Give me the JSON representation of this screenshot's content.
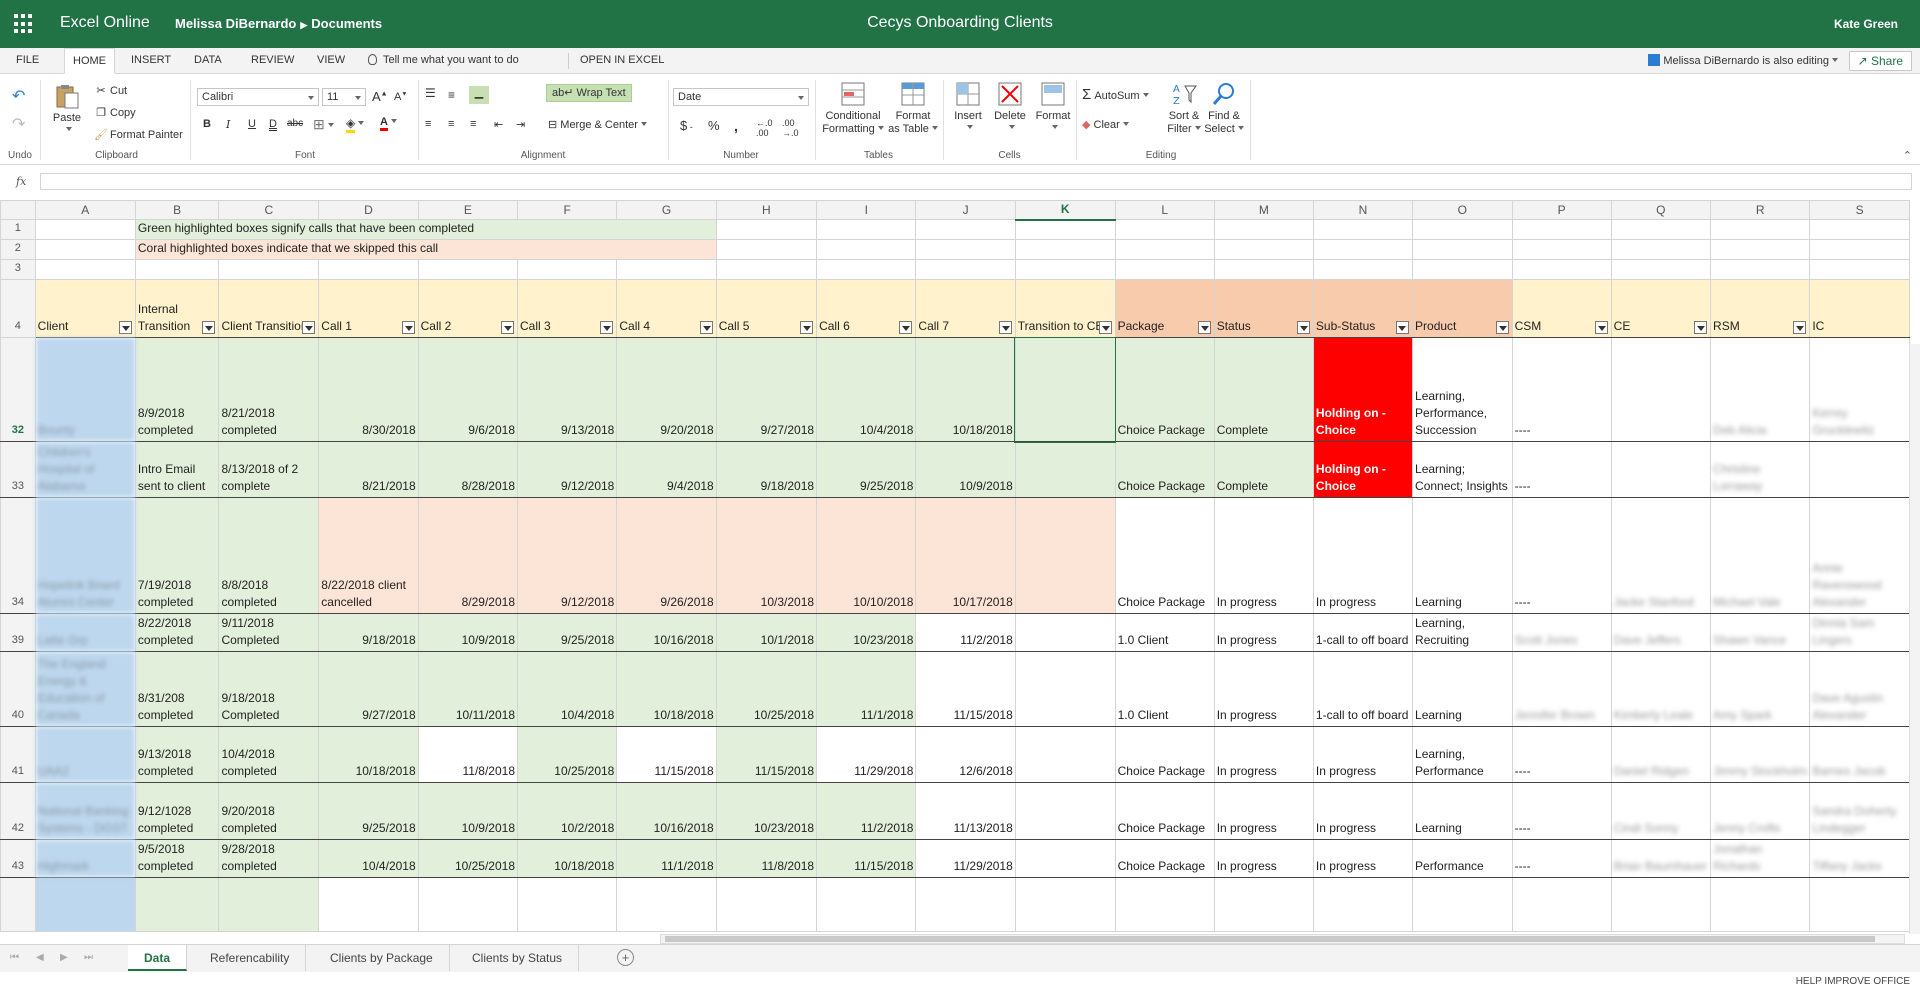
{
  "titlebar": {
    "app": "Excel Online",
    "owner": "Melissa DiBernardo",
    "folder": "Documents",
    "document": "Cecys Onboarding Clients",
    "user": "Kate Green"
  },
  "menu": {
    "tabs": [
      "FILE",
      "HOME",
      "INSERT",
      "DATA",
      "REVIEW",
      "VIEW"
    ],
    "tell_me": "Tell me what you want to do",
    "open_in_excel": "OPEN IN EXCEL",
    "coediting": "Melissa DiBernardo is also editing",
    "share": "Share"
  },
  "ribbon": {
    "undo": "Undo",
    "clipboard": {
      "paste": "Paste",
      "cut": "Cut",
      "copy": "Copy",
      "format_painter": "Format Painter",
      "label": "Clipboard"
    },
    "font": {
      "name": "Calibri",
      "size": "11",
      "label": "Font",
      "bold": "B",
      "italic": "I",
      "underline": "U",
      "double_underline": "D",
      "strike": "abc"
    },
    "alignment": {
      "wrap": "Wrap Text",
      "merge": "Merge & Center",
      "label": "Alignment"
    },
    "number": {
      "format": "Date",
      "currency": "$",
      "percent": "%",
      "comma": ",",
      "label": "Number"
    },
    "tables": {
      "conditional1": "Conditional",
      "conditional2": "Formatting",
      "format_table1": "Format",
      "format_table2": "as Table",
      "label": "Tables"
    },
    "cells": {
      "insert": "Insert",
      "delete": "Delete",
      "format": "Format",
      "label": "Cells"
    },
    "editing": {
      "autosum": "AutoSum",
      "clear": "Clear",
      "sort1": "Sort &",
      "sort2": "Filter",
      "find1": "Find &",
      "find2": "Select",
      "label": "Editing"
    }
  },
  "formula_bar": {
    "fx": "fx",
    "value": ""
  },
  "columns": [
    "A",
    "B",
    "C",
    "D",
    "E",
    "F",
    "G",
    "H",
    "I",
    "J",
    "K",
    "L",
    "M",
    "N",
    "O",
    "P",
    "Q",
    "R",
    "S"
  ],
  "selected_column": "K",
  "notes": {
    "row1": "Green highlighted boxes signify calls that have been completed",
    "row2": "Coral highlighted boxes indicate that we skipped this call"
  },
  "headers": [
    "Client",
    "Internal Transition",
    "Client Transition",
    "Call 1",
    "Call 2",
    "Call 3",
    "Call 4",
    "Call 5",
    "Call 6",
    "Call 7",
    "Transition to CE",
    "Package",
    "Status",
    "Sub-Status",
    "Product",
    "CSM",
    "CE",
    "RSM",
    "IC"
  ],
  "rows": [
    {
      "rownum": "32",
      "cells": [
        "Bounty",
        "8/9/2018 completed",
        "8/21/2018 completed",
        "8/30/2018",
        "9/6/2018",
        "9/13/2018",
        "9/20/2018",
        "9/27/2018",
        "10/4/2018",
        "10/18/2018",
        "",
        "Choice Package",
        "Complete",
        "Holding on - Choice",
        "Learning, Performance, Succession",
        "----",
        "",
        "Deb Alicia",
        "Kerrey Grucklewitz"
      ]
    },
    {
      "rownum": "33",
      "cells": [
        "Children's Hospital of Alabama",
        "Intro Email sent to client",
        "8/13/2018   of 2 complete",
        "8/21/2018",
        "8/28/2018",
        "9/12/2018",
        "9/4/2018",
        "9/18/2018",
        "9/25/2018",
        "10/9/2018",
        "",
        "Choice Package",
        "Complete",
        "Holding on - Choice",
        "Learning; Connect; Insights",
        "----",
        "",
        "Christine Lorraway",
        ""
      ]
    },
    {
      "rownum": "34",
      "cells": [
        "Hopelink Board Alumni Center",
        "7/19/2018 completed",
        "8/8/2018 completed",
        "8/22/2018 client cancelled",
        "8/29/2018",
        "9/12/2018",
        "9/26/2018",
        "10/3/2018",
        "10/10/2018",
        "10/17/2018",
        "",
        "Choice Package",
        "In progress",
        "In progress",
        "Learning",
        "----",
        "Jacke Stanford",
        "Michael Vale",
        "Annie Ravenswood Alexander"
      ]
    },
    {
      "rownum": "39",
      "cells": [
        "Latte Grp",
        "8/22/2018 completed",
        "9/11/2018 Completed",
        "9/18/2018",
        "10/9/2018",
        "9/25/2018",
        "10/16/2018",
        "10/1/2018",
        "10/23/2018",
        "11/2/2018",
        "",
        "1.0 Client",
        "In progress",
        "1-call to off board",
        "Learning, Recruiting",
        "Scott Jones",
        "Dave Jeffers",
        "Shawn Vance",
        "Dinnia Sam Lingers"
      ]
    },
    {
      "rownum": "40",
      "cells": [
        "The England Energy & Education of Canada",
        "8/31/208 completed",
        "9/18/2018 Completed",
        "9/27/2018",
        "10/11/2018",
        "10/4/2018",
        "10/18/2018",
        "10/25/2018",
        "11/1/2018",
        "11/15/2018",
        "",
        "1.0 Client",
        "In progress",
        "1-call to off board",
        "Learning",
        "Jennifer Brown",
        "Kimberly Leale",
        "Amy Spark",
        "Dave Agustin Alexander"
      ]
    },
    {
      "rownum": "41",
      "cells": [
        "UAA2",
        "9/13/2018 completed",
        "10/4/2018 completed",
        "10/18/2018",
        "11/8/2018",
        "10/25/2018",
        "11/15/2018",
        "11/15/2018",
        "11/29/2018",
        "12/6/2018",
        "",
        "Choice Package",
        "In progress",
        "In progress",
        "Learning, Performance",
        "----",
        "Daniel Ridgen",
        "Jimmy Stockholm",
        "Barnes Jacob"
      ]
    },
    {
      "rownum": "42",
      "cells": [
        "National Banking Systems - DGST",
        "9/12/1028 completed",
        "9/20/2018 completed",
        "9/25/2018",
        "10/9/2018",
        "10/2/2018",
        "10/16/2018",
        "10/23/2018",
        "11/2/2018",
        "11/13/2018",
        "",
        "Choice Package",
        "In progress",
        "In progress",
        "Learning",
        "----",
        "Cindi Sonny",
        "Jenny Crofts",
        "Sandra Doherty Lindegger"
      ]
    },
    {
      "rownum": "43",
      "cells": [
        "Highmark",
        "9/5/2018 completed",
        "9/28/2018 completed",
        "10/4/2018",
        "10/25/2018",
        "10/18/2018",
        "11/1/2018",
        "11/8/2018",
        "11/15/2018",
        "11/29/2018",
        "",
        "Choice Package",
        "In progress",
        "In progress",
        "Performance",
        "----",
        "Brian Baumhauer",
        "Jonathan Richards",
        "Tiffany Jacks"
      ]
    }
  ],
  "sheet_tabs": [
    "Data",
    "Referencability",
    "Clients by Package",
    "Clients by Status"
  ],
  "active_sheet": "Data",
  "status": {
    "help": "HELP IMPROVE OFFICE"
  },
  "colors": {
    "brand": "#217346",
    "green_fill": "#e2efda",
    "coral_fill": "#fce4d6",
    "header_fill": "#fff2cc",
    "header_orange": "#f8cbad",
    "client_fill": "#bdd7ee",
    "red_fill": "#ff0000"
  }
}
